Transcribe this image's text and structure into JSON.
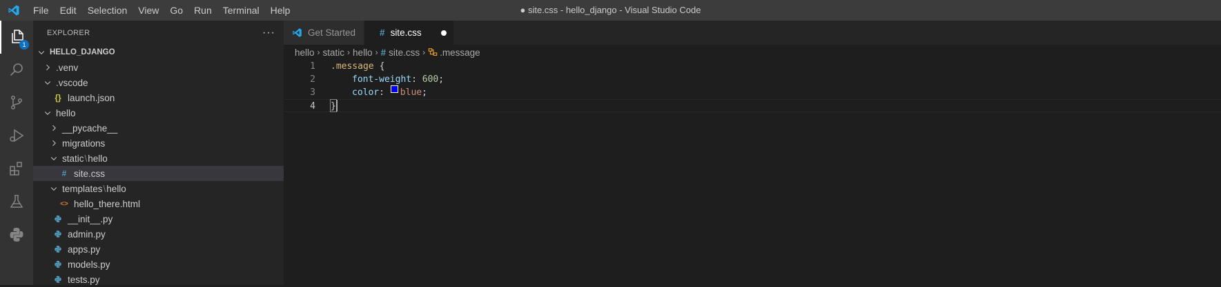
{
  "window": {
    "title": "● site.css - hello_django - Visual Studio Code",
    "menu": [
      "File",
      "Edit",
      "Selection",
      "View",
      "Go",
      "Run",
      "Terminal",
      "Help"
    ]
  },
  "activity_bar": {
    "items": [
      {
        "name": "explorer-icon",
        "badge": "1"
      },
      {
        "name": "search-icon"
      },
      {
        "name": "source-control-icon"
      },
      {
        "name": "run-debug-icon"
      },
      {
        "name": "extensions-icon"
      },
      {
        "name": "testing-icon"
      },
      {
        "name": "python-icon"
      }
    ]
  },
  "sidebar": {
    "title": "EXPLORER",
    "more": "···",
    "tree": [
      {
        "label": "HELLO_DJANGO",
        "kind": "root",
        "depth": 0,
        "twisty": "open"
      },
      {
        "label": ".venv",
        "kind": "folder",
        "depth": 1,
        "twisty": "closed"
      },
      {
        "label": ".vscode",
        "kind": "folder",
        "depth": 1,
        "twisty": "open"
      },
      {
        "label": "launch.json",
        "kind": "json",
        "depth": 2
      },
      {
        "label": "hello",
        "kind": "folder",
        "depth": 1,
        "twisty": "open"
      },
      {
        "label": "__pycache__",
        "kind": "folder",
        "depth": 2,
        "twisty": "closed"
      },
      {
        "label": "migrations",
        "kind": "folder",
        "depth": 2,
        "twisty": "closed"
      },
      {
        "label": "static",
        "label2": "hello",
        "kind": "folder",
        "depth": 2,
        "twisty": "open"
      },
      {
        "label": "site.css",
        "kind": "css",
        "depth": 3,
        "selected": true
      },
      {
        "label": "templates",
        "label2": "hello",
        "kind": "folder",
        "depth": 2,
        "twisty": "open"
      },
      {
        "label": "hello_there.html",
        "kind": "html",
        "depth": 3
      },
      {
        "label": "__init__.py",
        "kind": "py",
        "depth": 2
      },
      {
        "label": "admin.py",
        "kind": "py",
        "depth": 2
      },
      {
        "label": "apps.py",
        "kind": "py",
        "depth": 2
      },
      {
        "label": "models.py",
        "kind": "py",
        "depth": 2
      },
      {
        "label": "tests.py",
        "kind": "py",
        "depth": 2
      }
    ]
  },
  "tabs": [
    {
      "label": "Get Started",
      "icon": "vscode-logo-icon",
      "active": false
    },
    {
      "label": "site.css",
      "icon": "css-hash-icon",
      "active": true,
      "dirty": true
    }
  ],
  "breadcrumb": [
    "hello",
    "static",
    "hello",
    "site.css",
    ".message"
  ],
  "editor": {
    "lines": [
      {
        "no": "1",
        "selector": ".message",
        "brace": "{"
      },
      {
        "no": "2",
        "prop": "font-weight",
        "value": "600",
        "value_kind": "num"
      },
      {
        "no": "3",
        "prop": "color",
        "value": "blue",
        "value_kind": "color",
        "swatch": "#0000ff"
      },
      {
        "no": "4",
        "brace": "}",
        "current": true
      }
    ]
  },
  "colors": {
    "accent": "#0e70c0",
    "vscode_blue": "#23a9f2",
    "css_hash": "#519aba",
    "json": "#cbcb41",
    "html": "#e37933",
    "python": "#519aba"
  }
}
